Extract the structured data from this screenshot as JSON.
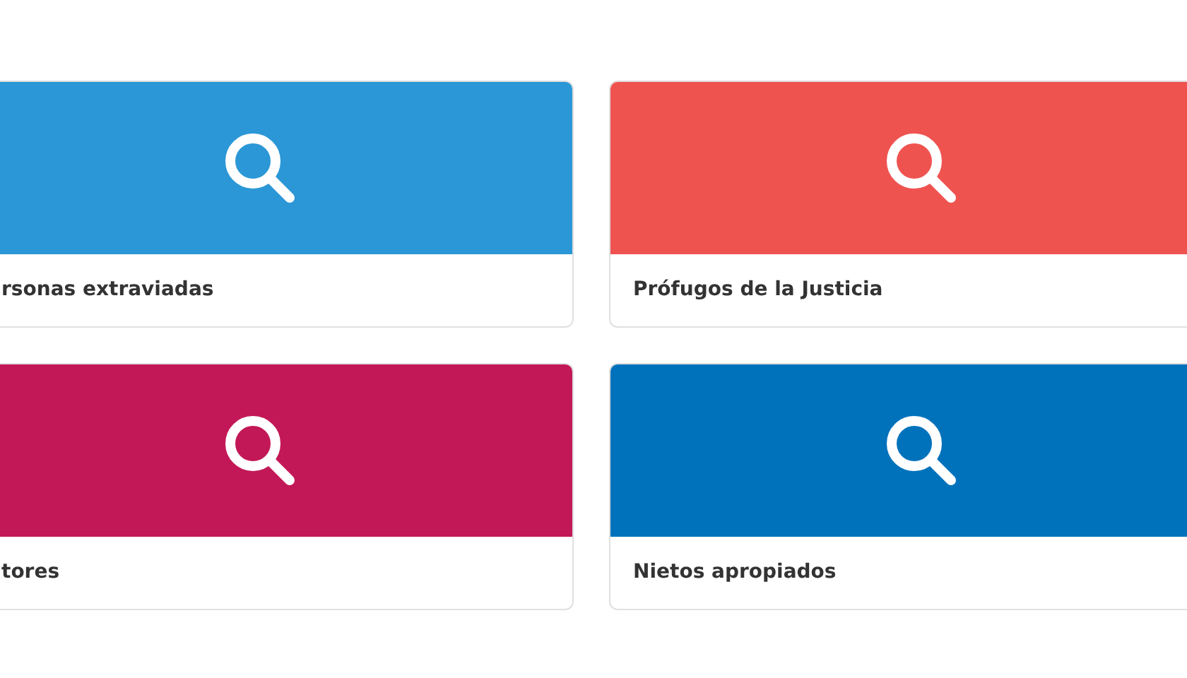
{
  "cards": [
    {
      "title": "rsonas extraviadas",
      "color": "#2b97d6"
    },
    {
      "title": "Prófugos de la Justicia",
      "color": "#ef5350"
    },
    {
      "title": "tores",
      "color": "#c21857"
    },
    {
      "title": "Nietos apropiados",
      "color": "#0072bb"
    }
  ]
}
